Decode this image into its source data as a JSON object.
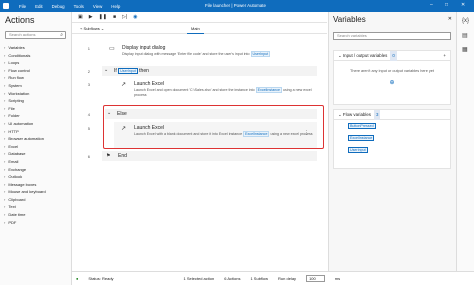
{
  "window": {
    "title": "File launcher | Power Automate",
    "menu": [
      "File",
      "Edit",
      "Debug",
      "Tools",
      "View",
      "Help"
    ]
  },
  "sidebar": {
    "title": "Actions",
    "search_placeholder": "Search actions",
    "items": [
      "Variables",
      "Conditionals",
      "Loops",
      "Flow control",
      "Run flow",
      "System",
      "Workstation",
      "Scripting",
      "File",
      "Folder",
      "UI automation",
      "HTTP",
      "Browser automation",
      "Excel",
      "Database",
      "Email",
      "Exchange",
      "Outlook",
      "Message boxes",
      "Mouse and keyboard",
      "Clipboard",
      "Text",
      "Date time",
      "PDF"
    ]
  },
  "tabs": {
    "subflows": "Subflows",
    "main": "Main"
  },
  "steps": [
    {
      "num": "1",
      "title": "Display input dialog",
      "desc_pre": "Display input dialog with message 'Enter file code' and store the user's input into",
      "var": "UserInput"
    },
    {
      "num": "2",
      "title": "If",
      "var": "UserInput",
      "suffix": "then"
    },
    {
      "num": "3",
      "title": "Launch Excel",
      "desc_pre": "Launch Excel and open document 'C:\\Sales.xlsx' and store the instance into",
      "var": "ExcelInstance",
      "desc_post": "using a new excel process"
    },
    {
      "num": "4",
      "title": "Else"
    },
    {
      "num": "5",
      "title": "Launch Excel",
      "desc_pre": "Launch Excel with a blank document and store it into Excel instance",
      "var": "ExcelInstance",
      "desc_post": "using a new excel process"
    },
    {
      "num": "6",
      "title": "End"
    }
  ],
  "status": {
    "state": "Status: Ready",
    "selected": "1 Selected action",
    "actions": "6 Actions",
    "subflows": "1 Subflow",
    "delay_label": "Run delay",
    "delay_value": "100",
    "unit": "ms"
  },
  "variables": {
    "title": "Variables",
    "search_placeholder": "Search variables",
    "io": {
      "title": "Input / output variables",
      "count": "0",
      "empty": "There aren't any input or output variables here yet"
    },
    "flow": {
      "title": "Flow variables",
      "count": "3",
      "items": [
        "ButtonPressed",
        "ExcelInstance",
        "UserInput"
      ]
    }
  }
}
